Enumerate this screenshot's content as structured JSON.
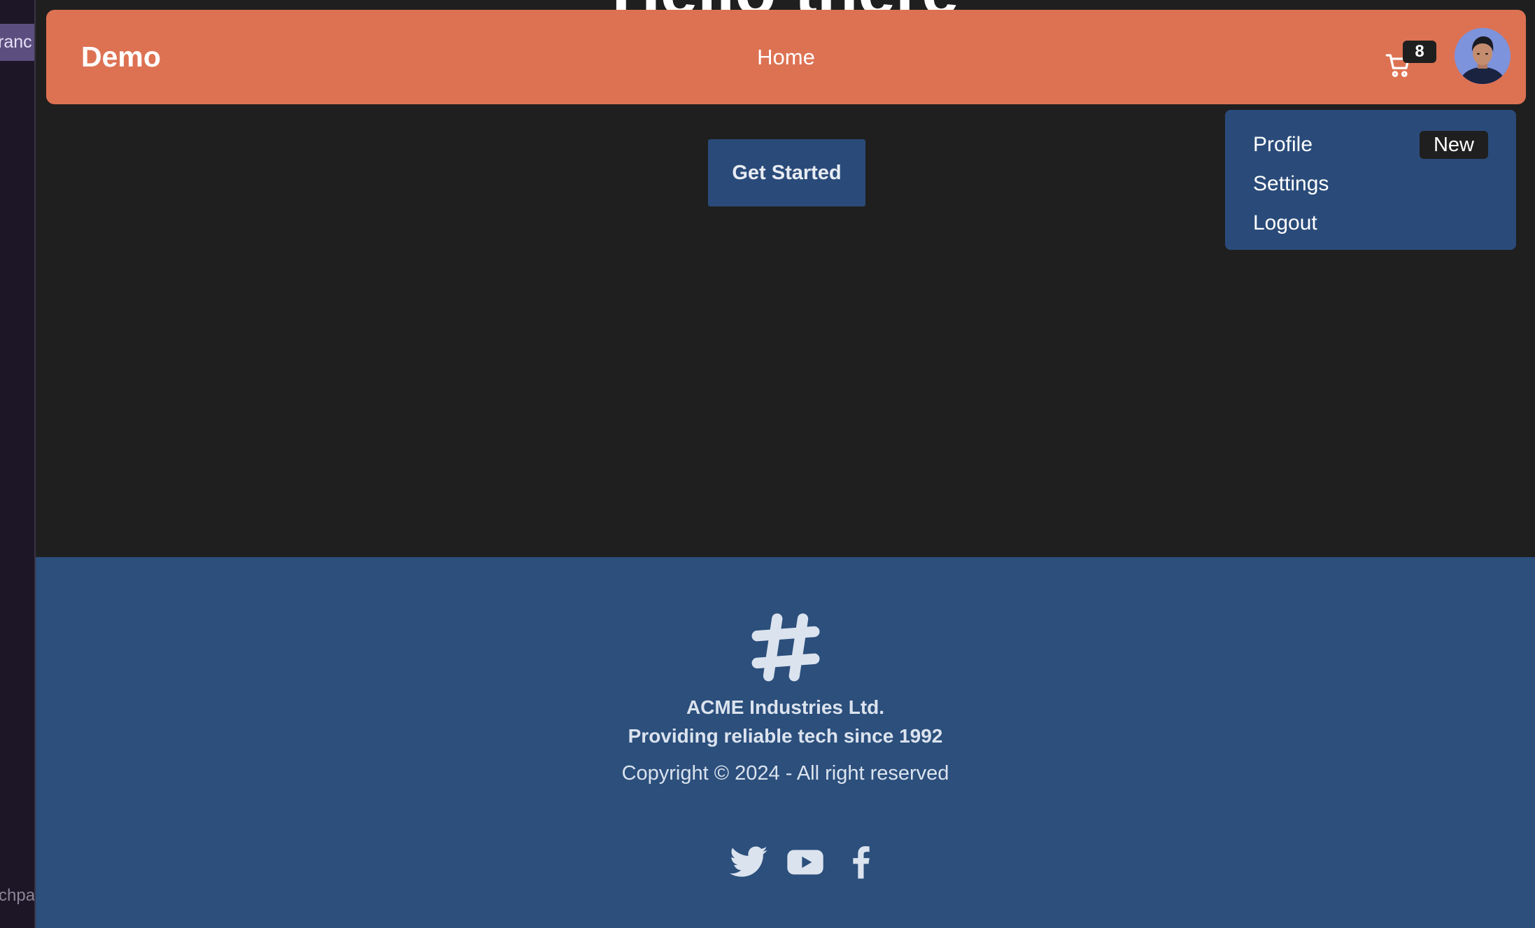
{
  "editor": {
    "tab_label": "ranc",
    "bottom_label": "chpa"
  },
  "hero": {
    "title": "Hello there"
  },
  "navbar": {
    "brand": "Demo",
    "links": [
      {
        "label": "Home"
      }
    ],
    "cart_count": "8",
    "colors": {
      "background": "#dd7253"
    }
  },
  "dropdown": {
    "items": [
      {
        "label": "Profile",
        "badge": "New"
      },
      {
        "label": "Settings"
      },
      {
        "label": "Logout"
      }
    ]
  },
  "cta": {
    "label": "Get Started"
  },
  "footer": {
    "company_line1": "ACME Industries Ltd.",
    "company_line2": "Providing reliable tech since 1992",
    "copyright": "Copyright © 2024 - All right reserved",
    "socials": [
      {
        "icon": "twitter-icon"
      },
      {
        "icon": "youtube-icon"
      },
      {
        "icon": "facebook-icon"
      }
    ],
    "colors": {
      "background": "#2c4f7c",
      "text": "#dbe3ee"
    }
  }
}
